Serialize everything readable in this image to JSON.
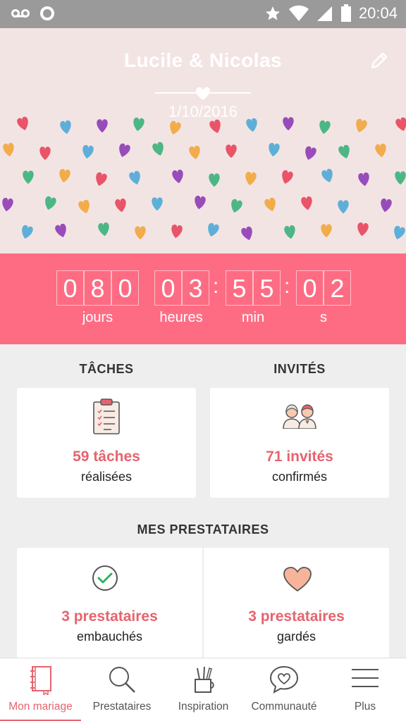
{
  "status_bar": {
    "time": "20:04"
  },
  "header": {
    "couple_names": "Lucile & Nicolas",
    "wedding_date": "1/10/2016"
  },
  "countdown": {
    "days": [
      "0",
      "8",
      "0"
    ],
    "hours": [
      "0",
      "3"
    ],
    "minutes": [
      "5",
      "5"
    ],
    "seconds": [
      "0",
      "2"
    ],
    "days_label": "jours",
    "hours_label": "heures",
    "minutes_label": "min",
    "seconds_label": "s",
    "separator": ":"
  },
  "tasks": {
    "title": "TÂCHES",
    "count_text": "59 tâches",
    "subtitle": "réalisées",
    "icon": "clipboard-checklist-icon"
  },
  "guests": {
    "title": "INVITÉS",
    "count_text": "71 invités",
    "subtitle": "confirmés",
    "icon": "guests-couple-icon"
  },
  "vendors": {
    "title": "MES PRESTATAIRES",
    "hired": {
      "count_text": "3 prestataires",
      "subtitle": "embauchés",
      "icon": "check-circle-icon"
    },
    "saved": {
      "count_text": "3 prestataires",
      "subtitle": "gardés",
      "icon": "heart-icon"
    }
  },
  "nav": {
    "items": [
      {
        "label": "Mon mariage",
        "icon": "notebook-icon",
        "active": true
      },
      {
        "label": "Prestataires",
        "icon": "search-icon",
        "active": false
      },
      {
        "label": "Inspiration",
        "icon": "pencil-cup-icon",
        "active": false
      },
      {
        "label": "Communauté",
        "icon": "chat-heart-icon",
        "active": false
      },
      {
        "label": "Plus",
        "icon": "menu-icon",
        "active": false
      }
    ]
  },
  "colors": {
    "accent": "#e5646e",
    "countdown_bg": "#fe6c84",
    "hero_bg": "#f3e4e4"
  }
}
